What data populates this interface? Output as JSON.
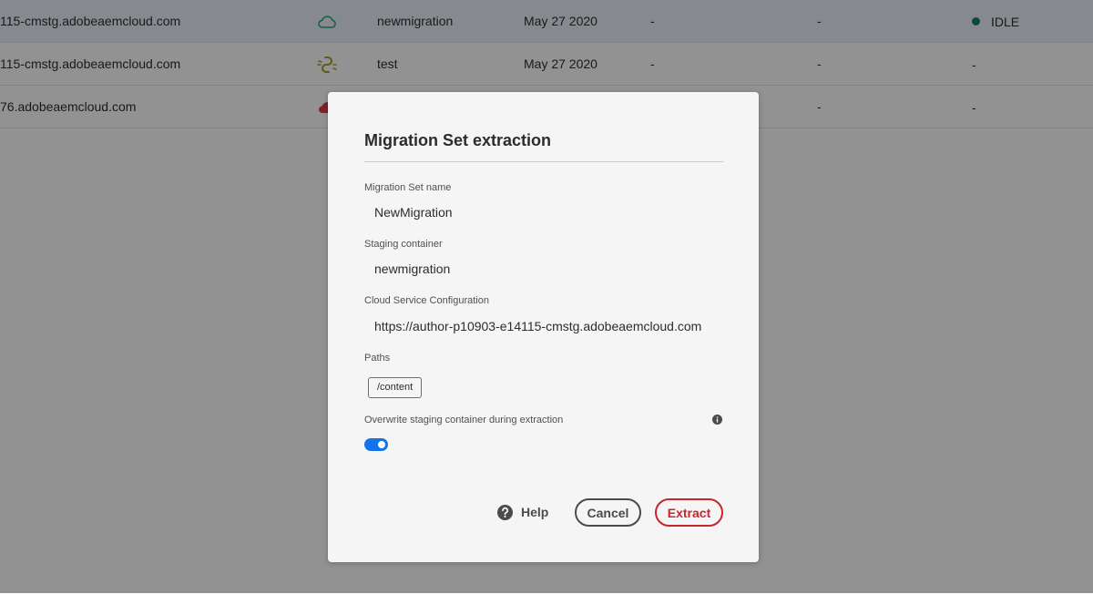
{
  "table": {
    "rows": [
      {
        "url": "115-cmstg.adobeaemcloud.com",
        "icon": "cloud-icon",
        "name": "newmigration",
        "date": "May 27 2020",
        "col5": "-",
        "col6": "-",
        "status": "IDLE"
      },
      {
        "url": "115-cmstg.adobeaemcloud.com",
        "icon": "broken-link-icon",
        "name": "test",
        "date": "May 27 2020",
        "col5": "-",
        "col6": "-",
        "status": "-"
      },
      {
        "url": "76.adobeaemcloud.com",
        "icon": "cloud-error-icon",
        "name": "",
        "date": "",
        "col5": "",
        "col6": "-",
        "status": "-"
      }
    ]
  },
  "dialog": {
    "title": "Migration Set extraction",
    "fields": {
      "name_label": "Migration Set name",
      "name_value": "NewMigration",
      "container_label": "Staging container",
      "container_value": "newmigration",
      "config_label": "Cloud Service Configuration",
      "config_value": "https://author-p10903-e14115-cmstg.adobeaemcloud.com",
      "paths_label": "Paths",
      "paths": [
        "/content"
      ],
      "overwrite_label": "Overwrite staging container during extraction",
      "overwrite_enabled": true
    },
    "buttons": {
      "help": "Help",
      "cancel": "Cancel",
      "extract": "Extract"
    }
  },
  "colors": {
    "accent": "#1473e6",
    "cta": "#c9252d",
    "status_idle": "#12805c",
    "cloud_ok": "#2d9d78",
    "link_warn": "#9a9a2a",
    "cloud_error": "#d7373f"
  }
}
